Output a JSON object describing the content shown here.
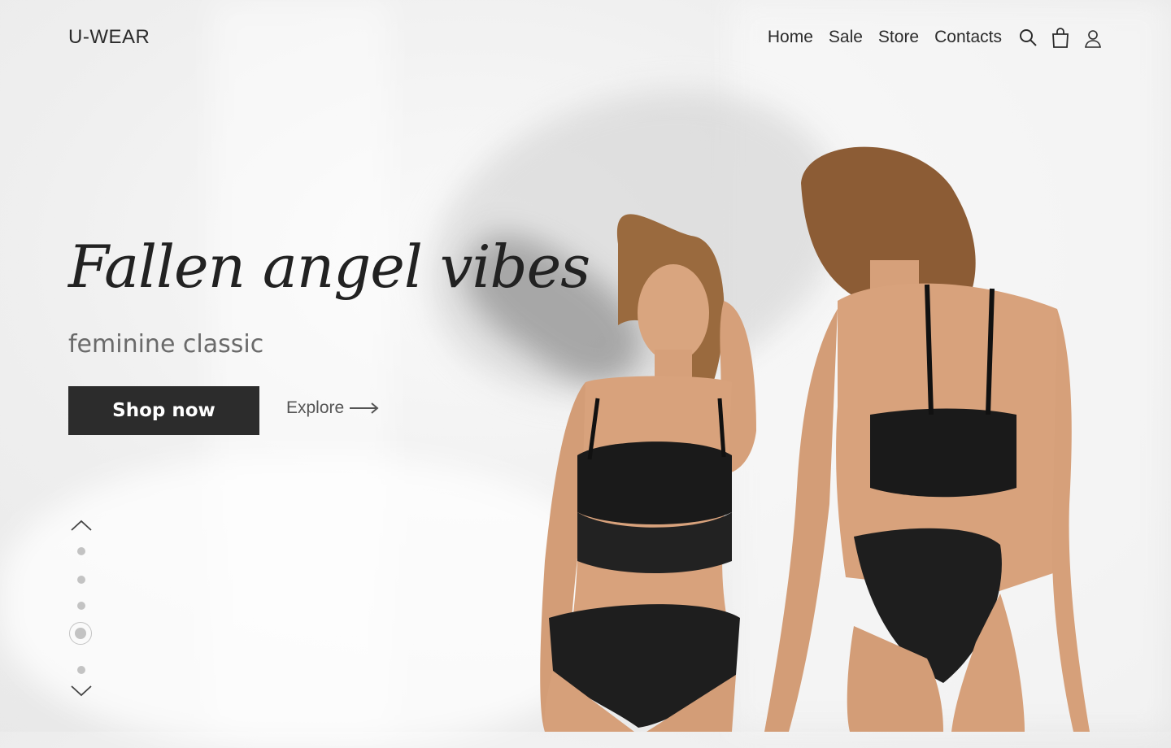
{
  "header": {
    "logo": "U-WEAR",
    "nav": [
      "Home",
      "Sale",
      "Store",
      "Contacts"
    ],
    "icons": [
      "search-icon",
      "cart-icon",
      "user-icon"
    ]
  },
  "hero": {
    "title": "Fallen angel vibes",
    "subtitle": "feminine classic",
    "shop_button": "Shop now",
    "explore_link": "Explore"
  },
  "pager": {
    "slides": 5,
    "active_index": 3
  },
  "colors": {
    "text": "#2b2b2b",
    "button": "#2c2c2c",
    "muted": "#6a6a6a",
    "dot": "#c3c3c3"
  }
}
